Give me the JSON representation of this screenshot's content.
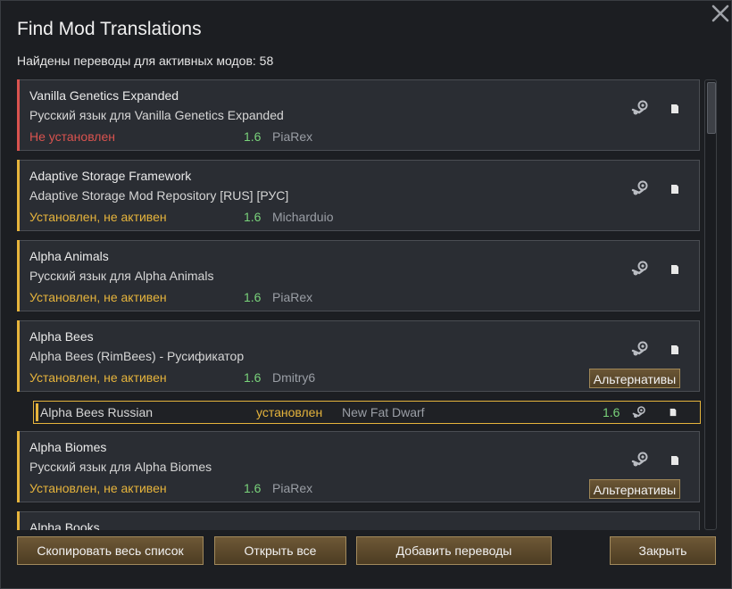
{
  "dialog": {
    "title": "Find Mod Translations",
    "summary": "Найдены переводы для активных модов: 58"
  },
  "colors": {
    "not_installed": "#d9534f",
    "installed_inactive": "#e6b43c",
    "version": "#79d27a"
  },
  "icons": {
    "steam": "steam-workshop-icon",
    "file": "file-icon",
    "close": "close-icon"
  },
  "entries": [
    {
      "mod": "Vanilla Genetics Expanded",
      "translation": "Русский язык для Vanilla Genetics Expanded",
      "status": "Не установлен",
      "version": "1.6",
      "author": "PiaRex"
    },
    {
      "mod": "Adaptive Storage Framework",
      "translation": "Adaptive Storage Mod Repository [RUS] [РУС]",
      "status": "Установлен, не активен",
      "version": "1.6",
      "author": "Micharduio"
    },
    {
      "mod": "Alpha Animals",
      "translation": "Русский язык для Alpha Animals",
      "status": "Установлен, не активен",
      "version": "1.6",
      "author": "PiaRex"
    },
    {
      "mod": "Alpha Bees",
      "translation": "Alpha Bees (RimBees) - Русификатор",
      "status": "Установлен, не активен",
      "version": "1.6",
      "author": "Dmitry6",
      "alternatives_label": "Альтернативы"
    },
    {
      "mod": "Alpha Biomes",
      "translation": "Русский язык для Alpha Biomes",
      "status": "Установлен, не активен",
      "version": "1.6",
      "author": "PiaRex",
      "alternatives_label": "Альтернативы"
    },
    {
      "mod": "Alpha Books"
    }
  ],
  "alternative": {
    "name": "Alpha Bees Russian",
    "status": "установлен",
    "author": "New Fat Dwarf",
    "version": "1.6"
  },
  "footer": {
    "copy_all": "Скопировать весь список",
    "open_all": "Открыть все",
    "add_translations": "Добавить переводы",
    "close": "Закрыть"
  }
}
